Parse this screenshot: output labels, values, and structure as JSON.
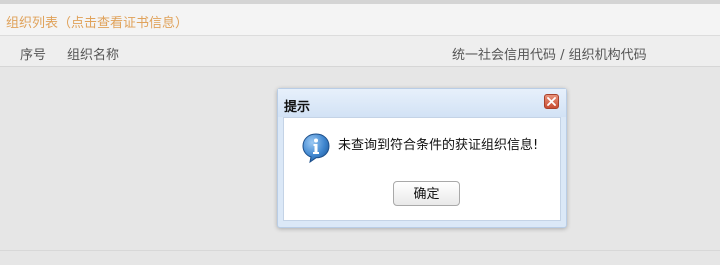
{
  "panel": {
    "title": "组织列表（点击查看证书信息）"
  },
  "table": {
    "columns": [
      "序号",
      "组织名称",
      "统一社会信用代码 / 组织机构代码"
    ]
  },
  "dialog": {
    "title": "提示",
    "message": "未查询到符合条件的获证组织信息!",
    "ok_label": "确定",
    "close_icon": "close-icon",
    "info_icon": "info-icon"
  },
  "colors": {
    "panel_title": "#e0a25a",
    "dialog_frame": "#dbe8f7",
    "close_button": "#c94d33",
    "info_icon": "#2d6fb6"
  }
}
